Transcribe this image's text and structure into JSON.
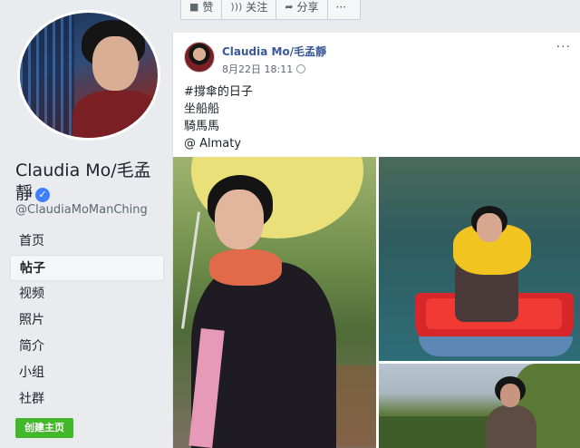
{
  "sidebar": {
    "name": "Claudia Mo/毛孟靜",
    "handle": "@ClaudiaMoManChing",
    "verified_icon": "check-icon",
    "nav_items": [
      {
        "label": "首页"
      },
      {
        "label": "帖子",
        "active": true
      },
      {
        "label": "视频"
      },
      {
        "label": "照片"
      },
      {
        "label": "简介"
      },
      {
        "label": "小组"
      },
      {
        "label": "社群"
      }
    ],
    "create_page_button": "创建主页"
  },
  "action_bar": {
    "items": [
      {
        "icon": "like-icon",
        "label": "赞"
      },
      {
        "icon": "rss-icon",
        "label": "关注"
      },
      {
        "icon": "share-icon",
        "label": "分享"
      },
      {
        "icon": "more-icon",
        "label": "···"
      }
    ]
  },
  "post": {
    "author": "Claudia Mo/毛孟靜",
    "timestamp": "8月22日 18:11",
    "privacy_icon": "globe-icon",
    "menu": "···",
    "lines": [
      "#撐傘的日子",
      "坐船船",
      "騎馬馬",
      "@ Almaty"
    ]
  },
  "colors": {
    "link": "#385898",
    "verified": "#4080ff",
    "create_button": "#42b72a",
    "background": "#e9ebee"
  }
}
